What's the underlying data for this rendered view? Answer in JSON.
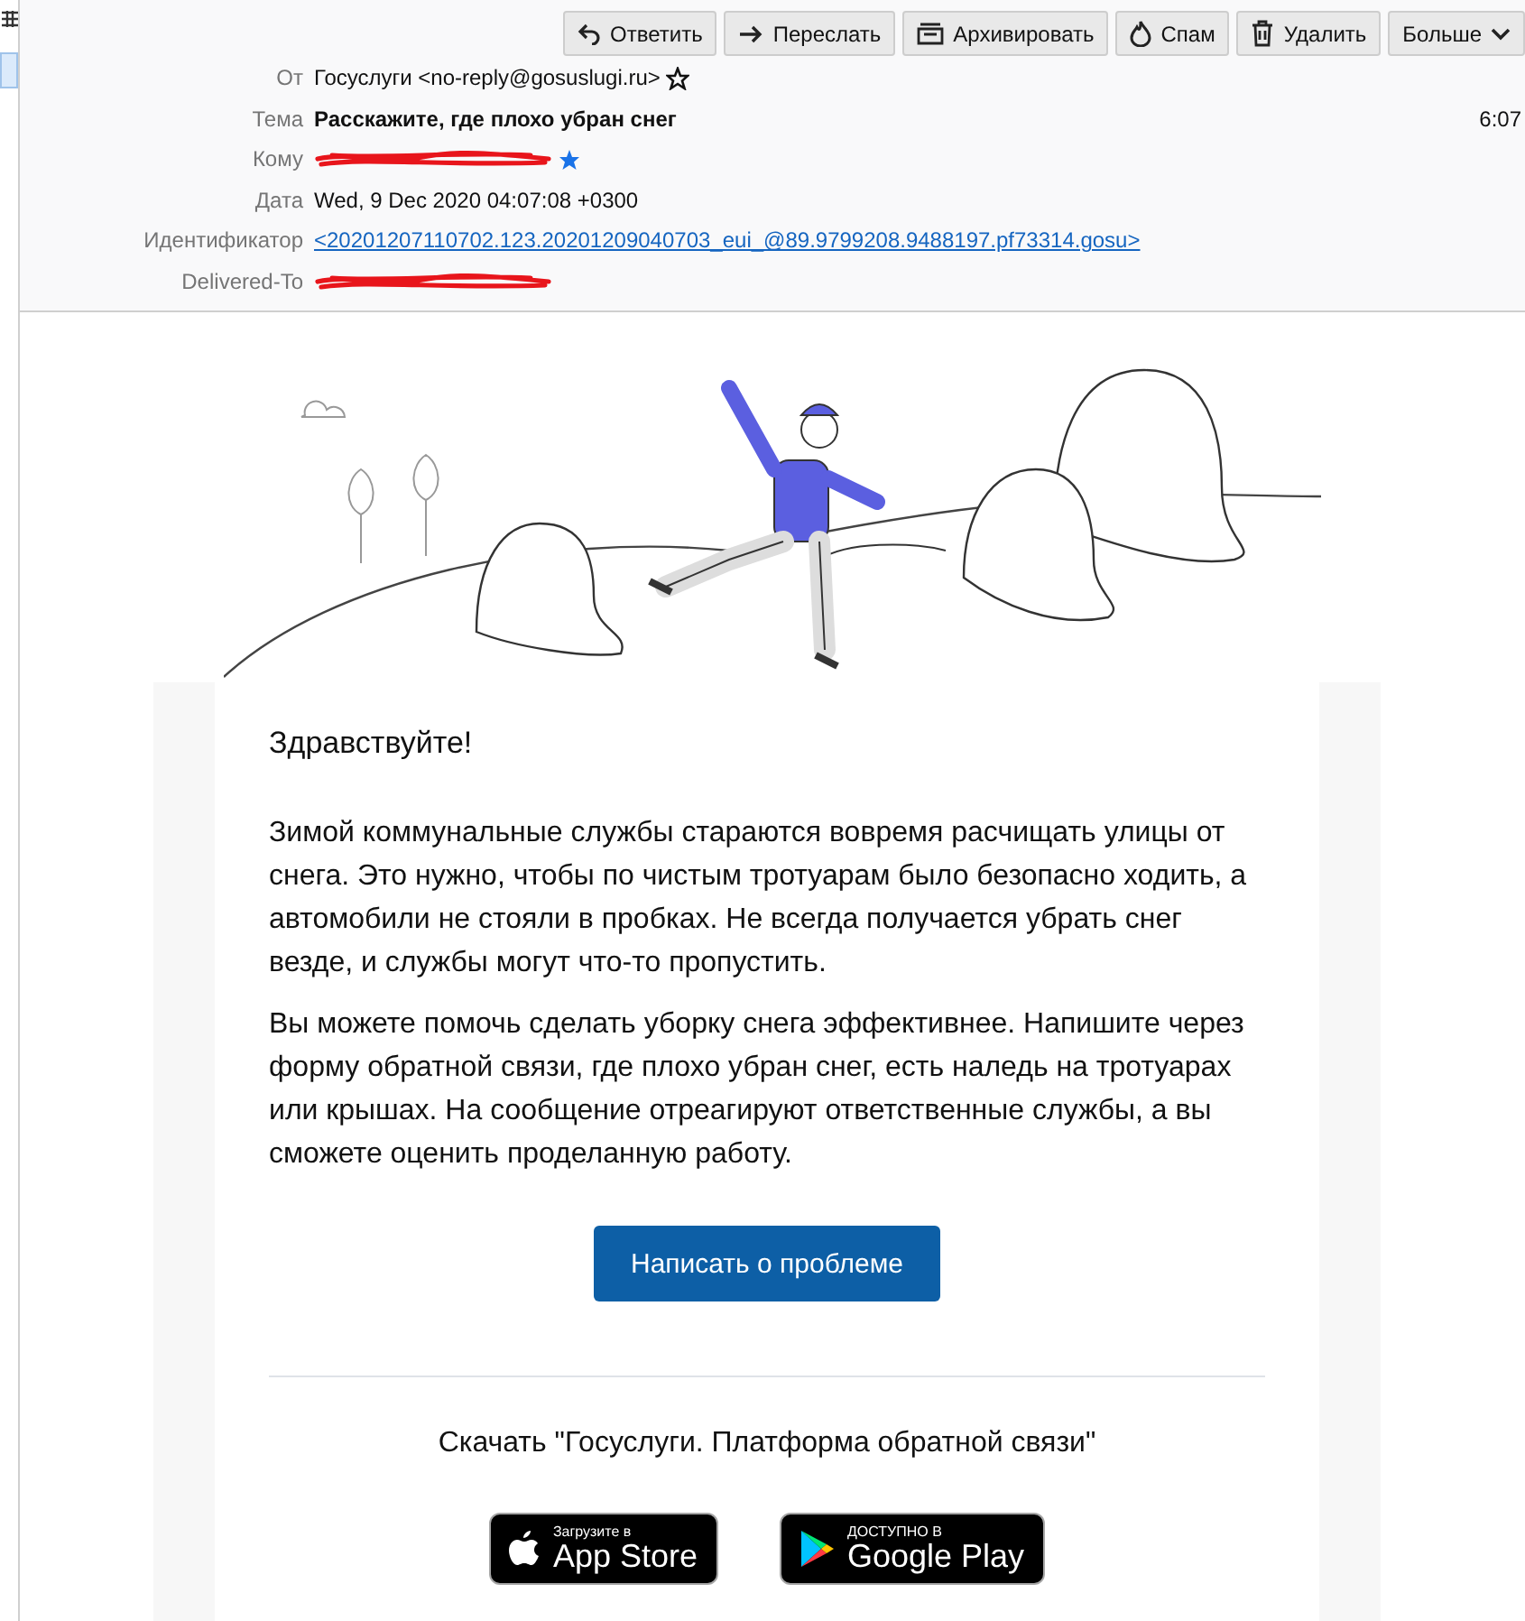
{
  "toolbar": [
    {
      "label": "Ответить",
      "kind": "reply"
    },
    {
      "label": "Переслать",
      "kind": "forward"
    },
    {
      "label": "Архивировать",
      "kind": "archive"
    },
    {
      "label": "Спам",
      "kind": "spam"
    },
    {
      "label": "Удалить",
      "kind": "trash"
    },
    {
      "label": "Больше",
      "kind": "more"
    }
  ],
  "headers": [
    {
      "label": "От",
      "kind": "sender",
      "value": "Госуслуги <no-reply@gosuslugi.ru>"
    },
    {
      "label": "Тема",
      "kind": "subject",
      "value": "Расскажите, где плохо убран снег"
    },
    {
      "label": "Кому",
      "kind": "redacted-starred"
    },
    {
      "label": "Дата",
      "kind": "plain",
      "value": "Wed, 9 Dec 2020 04:07:08 +0300"
    },
    {
      "label": "Идентификатор",
      "kind": "link",
      "value": "<20201207110702.123.20201209040703_eui_@89.9799208.9488197.pf73314.gosu>"
    },
    {
      "label": "Delivered-To",
      "kind": "redacted"
    }
  ],
  "time": "6:07",
  "body": {
    "greeting": "Здравствуйте!",
    "paragraphs": [
      "Зимой коммунальные службы стараются вовремя расчищать улицы от снега. Это нужно, чтобы по чистым тротуарам было безопасно ходить, а автомобили не стояли в пробках. Не всегда получается убрать снег везде, и службы могут что-то пропустить.",
      "Вы можете помочь сделать уборку снега эффективнее. Напишите через форму обратной связи, где плохо убран снег, есть наледь на тротуарах или крышах. На сообщение отреагируют ответственные службы, а вы сможете оценить проделанную работу."
    ],
    "button": "Написать о проблеме",
    "download_title": "Скачать \"Госуслуги. Платформа обратной связи\"",
    "badges": [
      {
        "kind": "apple",
        "caption": "Загрузите в",
        "store": "App Store"
      },
      {
        "kind": "google",
        "caption": "ДОСТУПНО В",
        "store": "Google Play"
      }
    ]
  }
}
